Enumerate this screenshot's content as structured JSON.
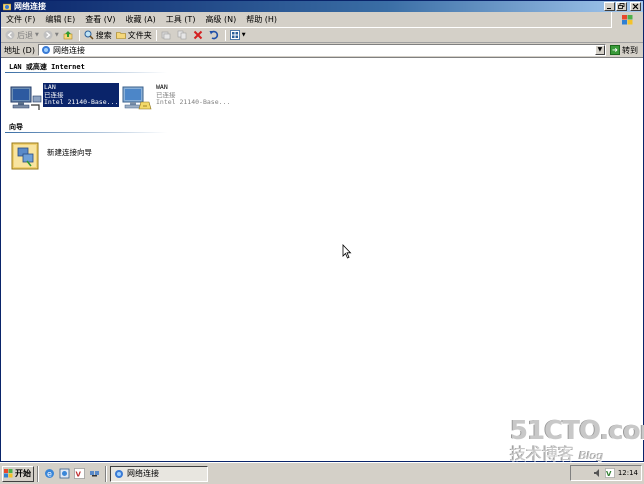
{
  "window": {
    "title": "网络连接"
  },
  "menu": {
    "items": [
      "文件 (F)",
      "编辑 (E)",
      "查看 (V)",
      "收藏 (A)",
      "工具 (T)",
      "高级 (N)",
      "帮助 (H)"
    ]
  },
  "toolbar": {
    "back": "后退",
    "search": "搜索",
    "folders": "文件夹"
  },
  "address": {
    "label": "地址 (D)",
    "value": "网络连接",
    "go": "转到"
  },
  "groups": {
    "lan": "LAN 或高速 Internet",
    "wizard": "向导"
  },
  "connections": [
    {
      "name": "LAN",
      "status": "已连接",
      "device": "Intel 21140-Base..."
    },
    {
      "name": "WAN",
      "status": "已连接",
      "device": "Intel 21140-Base..."
    }
  ],
  "wizard": {
    "label": "新建连接向导"
  },
  "watermark": {
    "site": "51CTO.com",
    "text": "技术博客",
    "blog": "Blog"
  },
  "taskbar": {
    "start": "开始",
    "task": "网络连接",
    "clock": "12:14"
  },
  "colors": {
    "selection": "#0a246a",
    "titlebar": "#0a246a",
    "chrome": "#d4d0c8"
  }
}
